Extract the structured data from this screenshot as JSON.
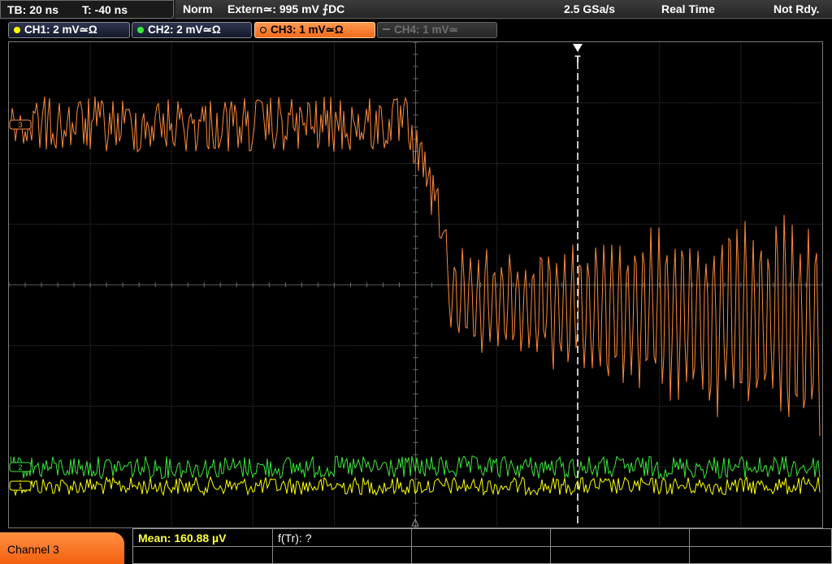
{
  "topbar": {
    "timebase": "TB: 20 ns",
    "trigger_time": "T: -40 ns",
    "acq_mode": "Norm",
    "trigger_source": "Extern≃: 995 mV ⨍DC",
    "sample_rate": "2.5 GSa/s",
    "mode": "Real Time",
    "status": "Not Rdy."
  },
  "channels": [
    {
      "label": "CH1: 2 mV≃Ω",
      "color": "#ffff00",
      "state": "on"
    },
    {
      "label": "CH2: 2 mV≃Ω",
      "color": "#38e838",
      "state": "on"
    },
    {
      "label": "CH3: 1 mV≃Ω",
      "color": "#ff8a3c",
      "state": "active"
    },
    {
      "label": "CH4: 1 mV≃",
      "color": "#707070",
      "state": "off"
    }
  ],
  "markers": {
    "ch3_marker": "3",
    "ch2_marker": "2",
    "ch1_marker": "1",
    "trigger_marker": "T"
  },
  "bottombar": {
    "channel_label": "Channel 3",
    "mean": "Mean: 160.88 µV",
    "ftr": "f(Tr): ?"
  },
  "colors": {
    "ch1": "#ffff00",
    "ch2": "#38e838",
    "ch3": "#ff8a3c",
    "grid": "#4a4a4a",
    "accent": "#f26b1a"
  }
}
